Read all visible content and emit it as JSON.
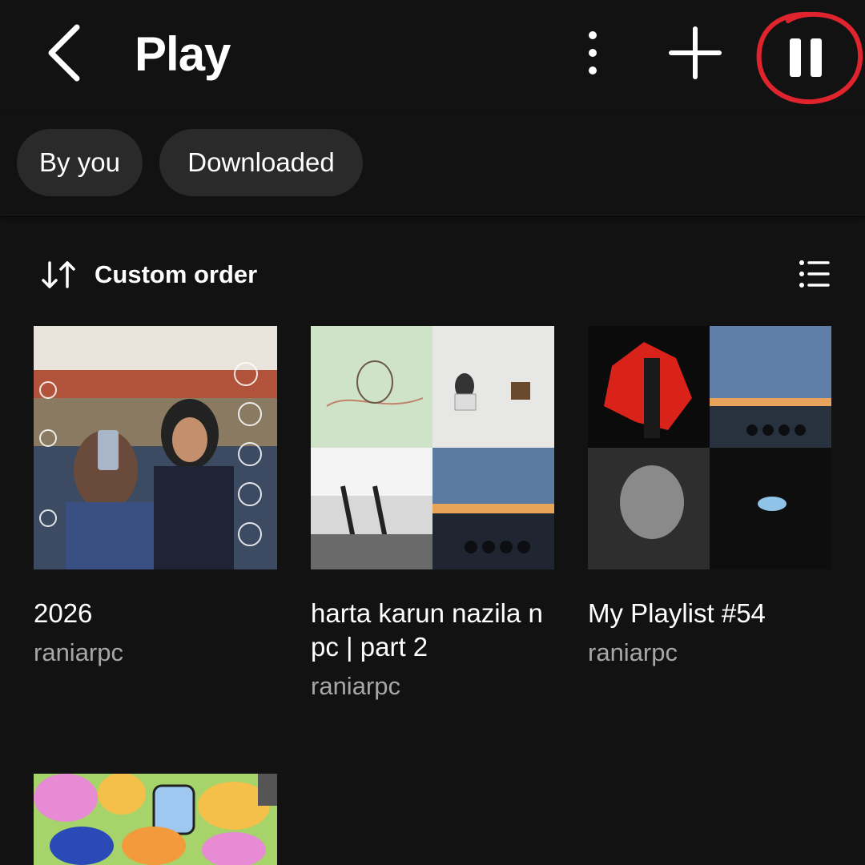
{
  "header": {
    "title": "Play",
    "icons": {
      "back": "back-arrow-icon",
      "more": "more-vertical-icon",
      "add": "plus-icon",
      "pause": "pause-icon"
    },
    "annotation_color": "#e0242d"
  },
  "filters": [
    {
      "label": "By you"
    },
    {
      "label": "Downloaded"
    }
  ],
  "sort": {
    "label": "Custom order",
    "icon": "sort-arrows-icon",
    "view_icon": "list-view-icon"
  },
  "playlists": [
    {
      "title": "2026",
      "owner": "raniarpc"
    },
    {
      "title": "harta karun nazila n pc | part 2",
      "owner": "raniarpc"
    },
    {
      "title": "My Playlist #54",
      "owner": "raniarpc"
    },
    {
      "title": "",
      "owner": ""
    }
  ],
  "colors": {
    "background": "#121212",
    "chip": "#2a2a2a",
    "secondary_text": "#a7a7a7"
  }
}
